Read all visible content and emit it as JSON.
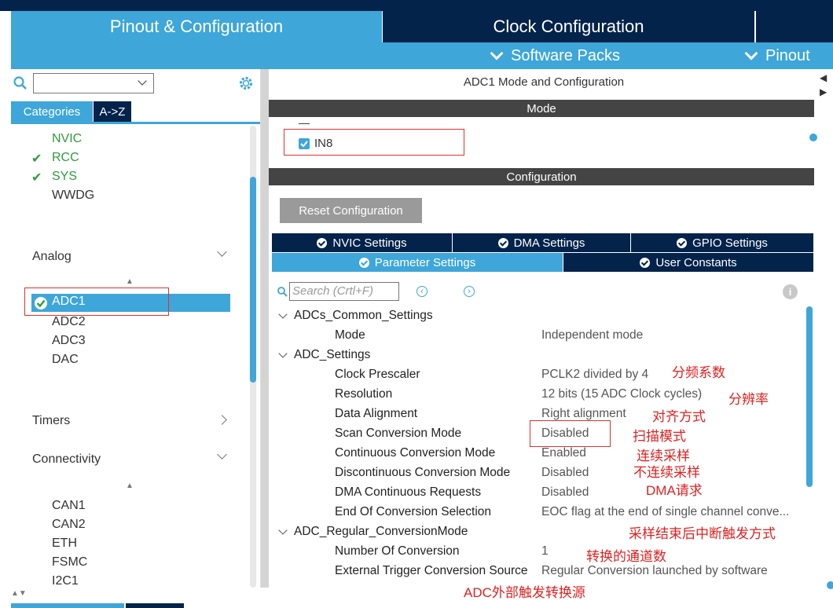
{
  "header": {
    "tab_pinout": "Pinout & Configuration",
    "tab_clock": "Clock Configuration",
    "software_packs": "Software Packs",
    "pinout": "Pinout"
  },
  "left": {
    "tab_categories": "Categories",
    "tab_az": "A->Z",
    "system_items": [
      "NVIC",
      "RCC",
      "SYS",
      "WWDG"
    ],
    "analog_label": "Analog",
    "analog_items": [
      "ADC1",
      "ADC2",
      "ADC3",
      "DAC"
    ],
    "timers_label": "Timers",
    "connectivity_label": "Connectivity",
    "connectivity_items": [
      "CAN1",
      "CAN2",
      "ETH",
      "FSMC",
      "I2C1"
    ]
  },
  "right": {
    "title": "ADC1 Mode and Configuration",
    "mode_band": "Mode",
    "mode_dash": "—",
    "in8_label": "IN8",
    "config_band": "Configuration",
    "reset_button": "Reset Configuration",
    "tabs_row1": [
      "NVIC Settings",
      "DMA Settings",
      "GPIO Settings"
    ],
    "tabs_row2": [
      "Parameter Settings",
      "User Constants"
    ],
    "search_placeholder": "Search (Crtl+F)",
    "groups": {
      "common": "ADCs_Common_Settings",
      "settings": "ADC_Settings",
      "regular": "ADC_Regular_ConversionMode"
    },
    "params": [
      {
        "label": "Mode",
        "value": "Independent mode"
      },
      {
        "label": "Clock Prescaler",
        "value": "PCLK2 divided by 4"
      },
      {
        "label": "Resolution",
        "value": "12 bits (15 ADC Clock cycles)"
      },
      {
        "label": "Data Alignment",
        "value": "Right alignment"
      },
      {
        "label": "Scan Conversion Mode",
        "value": "Disabled"
      },
      {
        "label": "Continuous Conversion Mode",
        "value": "Enabled"
      },
      {
        "label": "Discontinuous Conversion Mode",
        "value": "Disabled"
      },
      {
        "label": "DMA Continuous Requests",
        "value": "Disabled"
      },
      {
        "label": "End Of Conversion Selection",
        "value": "EOC flag at the end of single channel conve..."
      },
      {
        "label": "Number Of Conversion",
        "value": "1"
      },
      {
        "label": "External Trigger Conversion Source",
        "value": "Regular Conversion launched by software"
      }
    ]
  },
  "annotations": [
    "分频系数",
    "分辨率",
    "对齐方式",
    "扫描模式",
    "连续采样",
    "不连续采样",
    "DMA请求",
    "采样结束后中断触发方式",
    "转换的通道数",
    "ADC外部触发转换源"
  ],
  "colors": {
    "accent": "#3ea6d8",
    "dark": "#03234b",
    "annotation": "#e02020",
    "ok": "#2e9c3c"
  }
}
